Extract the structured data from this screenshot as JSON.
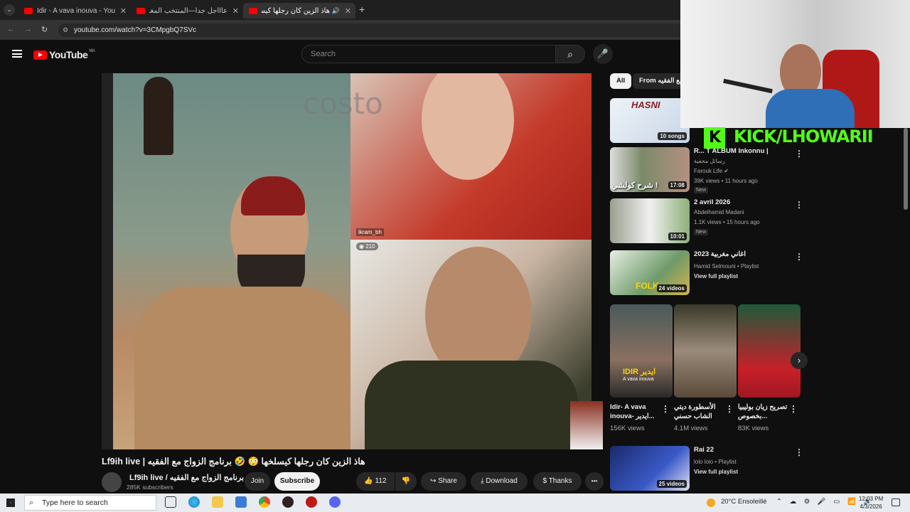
{
  "browser": {
    "tabs": [
      {
        "title": "Idir - A vava inouva - YouTube"
      },
      {
        "title": "عاااجل جدا—المنتخب المغربي و"
      },
      {
        "title": "هاذ الزين كان رجلها كيسلخها"
      }
    ],
    "new_tab": "+",
    "url": "youtube.com/watch?v=3CMpgbQ7SVc"
  },
  "youtube": {
    "logo_text": "YouTube",
    "region": "MA",
    "search_placeholder": "Search",
    "video_overlay": {
      "watermark": "costo",
      "user_tag": "ikram_bh",
      "viewer_count": "210"
    },
    "video": {
      "title": "Lf9ih live | هاذ الزين كان رجلها كيسلخها 😳 🤣 برنامج الزواج مع الفقيه",
      "channel": "Lf9ih live / برنامج الزواج مع الفقيه",
      "subscribers": "285K subscribers",
      "join": "Join",
      "subscribe": "Subscribe",
      "likes": "112",
      "share": "Share",
      "download": "Download",
      "thanks": "Thanks",
      "more": "•••"
    },
    "chips": [
      "All",
      "From برنامج الزواج مع الفقيه"
    ],
    "recommendations": [
      {
        "thumb_text": "HASNI",
        "badge": "10 songs",
        "title": "",
        "meta1": "",
        "meta2": "",
        "new": ""
      },
      {
        "thumb_text": "شرح كولشي !",
        "badge": "17:08",
        "title": "R... T ALBUM Inkonnu |",
        "meta1": "رسائل مخفية",
        "meta2": "Farouk Life ✔",
        "meta3": "39K views • 11 hours ago",
        "new": "New"
      },
      {
        "thumb_text": "",
        "badge": "10:01",
        "title": "2 avril 2026",
        "meta1": "Abdelhamid Madani",
        "meta2": "1.1K views • 15 hours ago",
        "new": "New"
      },
      {
        "thumb_text": "FOLK",
        "badge": "24 videos",
        "title": "2023 اغاني مغربية",
        "meta1": "Hamid Selmouni • Playlist",
        "meta2": "View full playlist",
        "new": ""
      },
      {
        "thumb_text": "",
        "badge": "25 videos",
        "title": "Rai 22",
        "meta1": "lolo lolo • Playlist",
        "meta2": "View full playlist",
        "new": ""
      }
    ],
    "shelf": [
      {
        "title": "Idir- A vava inouva- ايدير...",
        "views": "156K views",
        "thumb_text": "IDIR ايدير",
        "sub_text": "A vava inouva"
      },
      {
        "title": "الأسطورة ديتي الشاب حسني",
        "views": "4.1M views"
      },
      {
        "title": "تصريح زيان بوليبيا بخصوص...",
        "views": "83K views"
      }
    ]
  },
  "stream_overlay": {
    "kick_text": "KICK/LHOWARII"
  },
  "taskbar": {
    "search_placeholder": "Type here to search",
    "weather": "20°C Ensoleillé",
    "time": "12:03 PM",
    "date": "4/3/2026"
  },
  "colors": {
    "youtube_red": "#ff0000",
    "kick_green": "#53fc18",
    "bg": "#0f0f0f"
  }
}
